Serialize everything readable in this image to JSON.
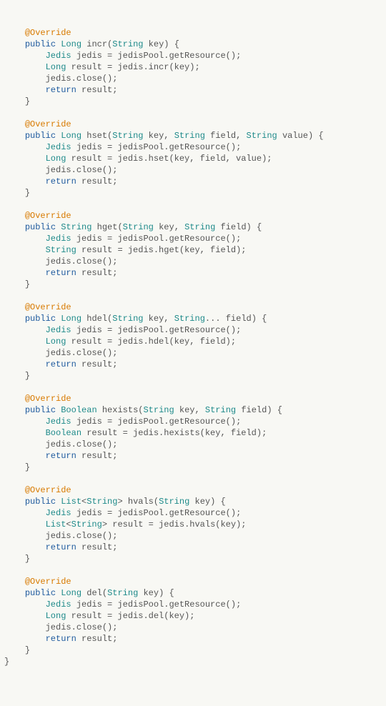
{
  "lang": "java",
  "annotation": "@Override",
  "kw": {
    "public": "public",
    "return": "return"
  },
  "types": {
    "Long": "Long",
    "String": "String",
    "Jedis": "Jedis",
    "Boolean": "Boolean",
    "List": "List"
  },
  "common": {
    "getRes": " jedis = jedisPool.getResource();",
    "close": "jedis.close();",
    "retRes": " result;"
  },
  "m1": {
    "sig1": " incr(",
    "p1": " key) {",
    "body": " result = jedis.incr(key);"
  },
  "m2": {
    "sig1": " hset(",
    "p1": " key, ",
    "p2": " field, ",
    "p3": " value) {",
    "body": " result = jedis.hset(key, field, value);"
  },
  "m3": {
    "sig1": " hget(",
    "p1": " key, ",
    "p2": " field) {",
    "body": " result = jedis.hget(key, field);"
  },
  "m4": {
    "sig1": " hdel(",
    "p1": " key, ",
    "p2": "... field) {",
    "body": " result = jedis.hdel(key, field);"
  },
  "m5": {
    "sig1": " hexists(",
    "p1": " key, ",
    "p2": " field) {",
    "body": " result = jedis.hexists(key, field);"
  },
  "m6": {
    "sigPre": "<",
    "sigPost": "> hvals(",
    "p1": " key) {",
    "bodyPre": "<",
    "bodyPost": "> result = jedis.hvals(key);"
  },
  "m7": {
    "sig1": " del(",
    "p1": " key) {",
    "body": " result = jedis.del(key);"
  },
  "braceClose": "}",
  "finalBrace": "}"
}
